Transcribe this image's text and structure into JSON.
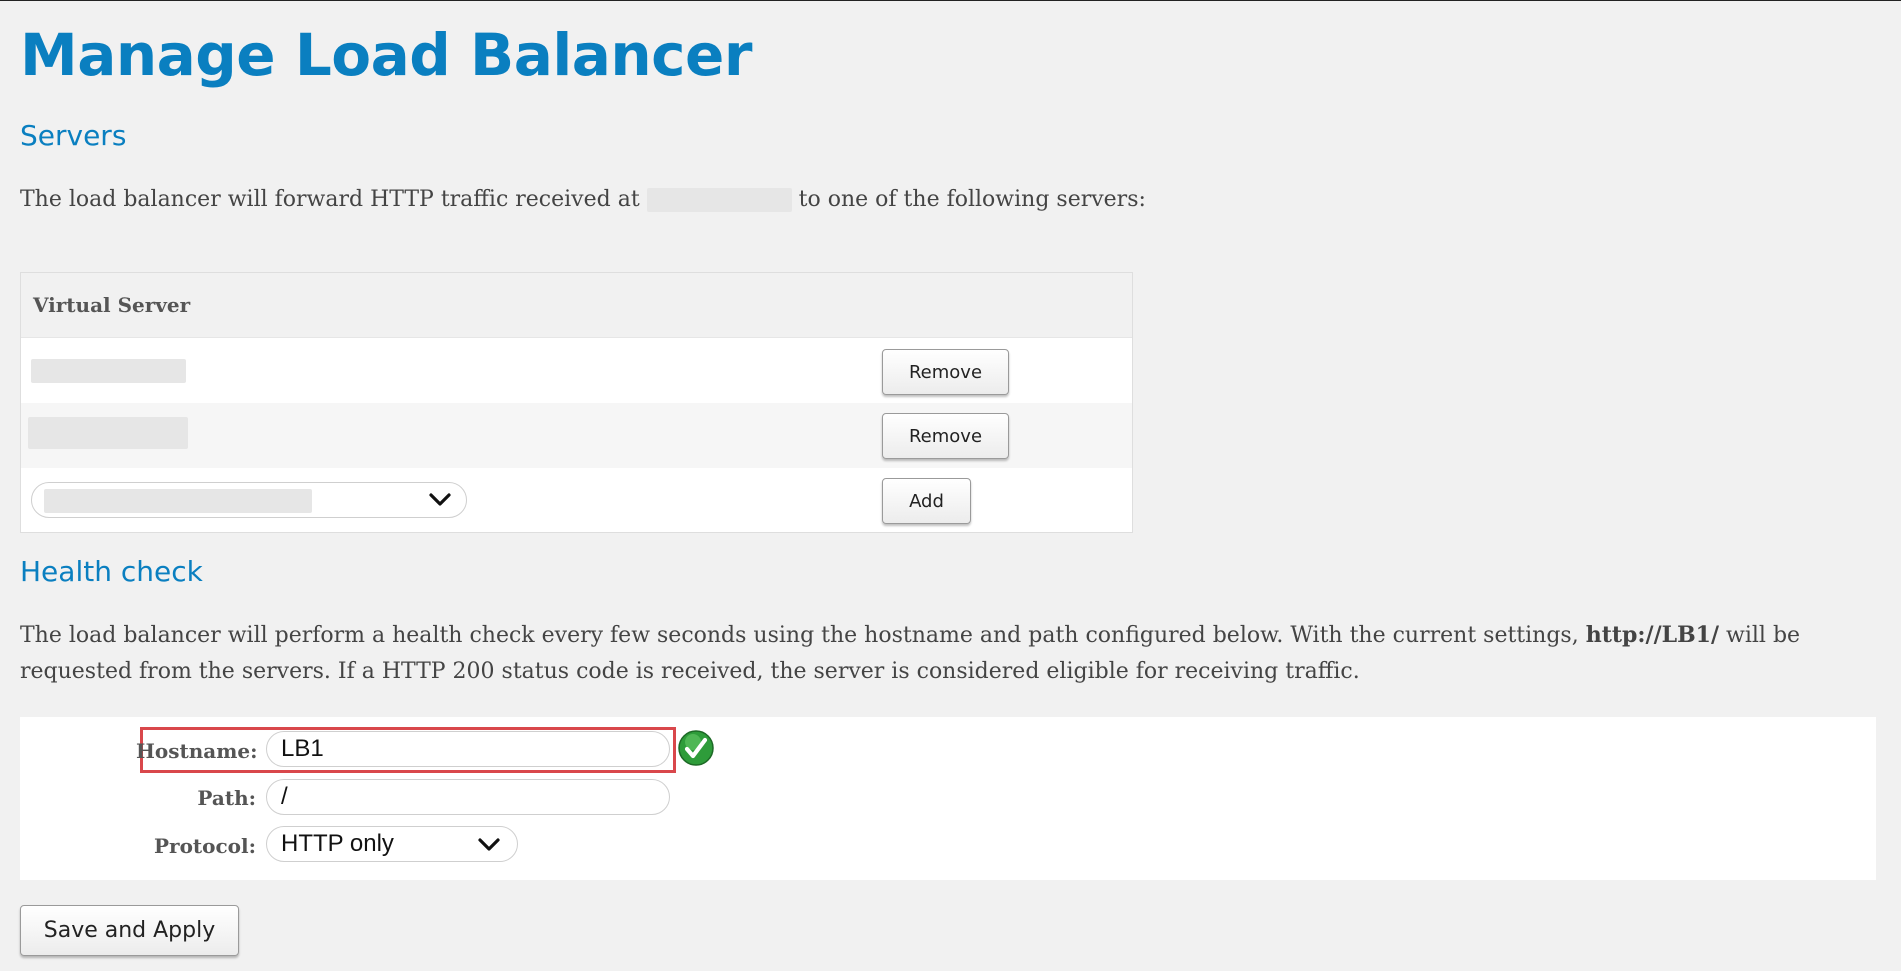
{
  "page": {
    "title": "Manage Load Balancer"
  },
  "servers": {
    "heading": "Servers",
    "desc_before": "The load balancer will forward HTTP traffic received at",
    "desc_after": "to one of the following servers:",
    "table": {
      "header": "Virtual Server",
      "rows": [
        {
          "remove_label": "Remove"
        },
        {
          "remove_label": "Remove"
        }
      ],
      "add_label": "Add"
    }
  },
  "health": {
    "heading": "Health check",
    "desc_part1": "The load balancer will perform a health check every few seconds using the hostname and path configured below. With the current settings,",
    "desc_url": "http://LB1/",
    "desc_part2": "will be requested from the servers. If a HTTP 200 status code is received, the server is considered eligible for receiving traffic.",
    "fields": {
      "hostname_label": "Hostname:",
      "hostname_value": "LB1",
      "path_label": "Path:",
      "path_value": "/",
      "protocol_label": "Protocol:",
      "protocol_value": "HTTP only"
    },
    "status_icon": "green-check-icon",
    "accent": "#0a7fc0",
    "highlight_color": "#d9474b"
  },
  "actions": {
    "save_label": "Save and Apply"
  }
}
